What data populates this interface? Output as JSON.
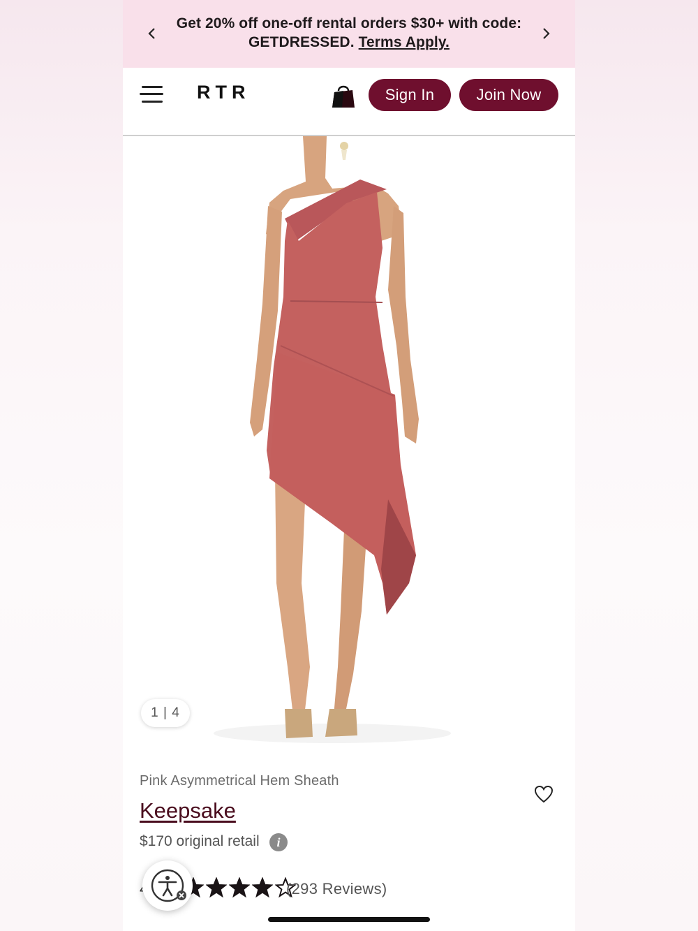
{
  "promo": {
    "line1": "Get 20% off one-off rental orders $30+ with code:",
    "code": "GETDRESSED.",
    "terms": "Terms Apply."
  },
  "header": {
    "logo": "RTR",
    "sign_in": "Sign In",
    "join_now": "Join Now"
  },
  "gallery": {
    "counter": "1 | 4"
  },
  "product": {
    "subtitle": "Pink Asymmetrical Hem Sheath",
    "brand": "Keepsake",
    "price": "$170 original retail",
    "info_icon_glyph": "i",
    "rating_prefix": "4",
    "star_rating_filled": 4,
    "star_rating_max": 5,
    "reviews": "(293 Reviews)"
  },
  "colors": {
    "brand_burgundy": "#6f0f2e",
    "promo_bg": "#f9e0ea",
    "dress": "#c4615f"
  },
  "icons": [
    "chevron-left-icon",
    "chevron-right-icon",
    "hamburger-menu-icon",
    "shopping-bag-icon",
    "heart-icon",
    "info-icon",
    "star-icon",
    "accessibility-icon"
  ]
}
